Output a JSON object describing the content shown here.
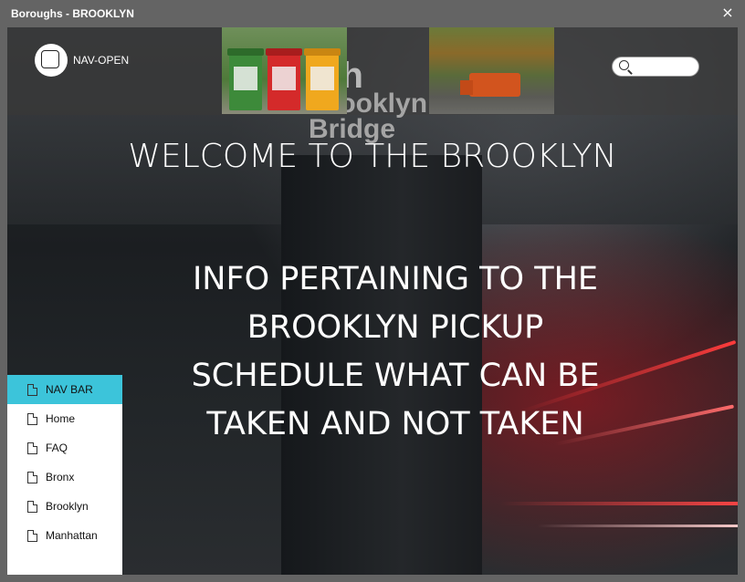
{
  "window": {
    "title": "Boroughs - BROOKLYN",
    "close_icon": "×"
  },
  "header": {
    "nav_open_label": "NAV-OPEN",
    "sign_line1": "igh",
    "sign_line2": "Brooklyn",
    "sign_line3": "Bridge",
    "search": {
      "placeholder": "",
      "value": ""
    }
  },
  "main": {
    "welcome": "WELCOME TO THE BROOKLYN",
    "info_lines": [
      "INFO PERTAINING TO THE",
      "BROOKLYN PICKUP",
      "SCHEDULE  WHAT CAN BE",
      "TAKEN AND NOT TAKEN"
    ]
  },
  "navbar": {
    "items": [
      {
        "label": "NAV BAR",
        "active": true
      },
      {
        "label": "Home"
      },
      {
        "label": "FAQ"
      },
      {
        "label": "Bronx"
      },
      {
        "label": "Brooklyn"
      },
      {
        "label": "Manhattan"
      }
    ]
  },
  "colors": {
    "accent": "#3cc4da",
    "titlebar": "#646464"
  }
}
